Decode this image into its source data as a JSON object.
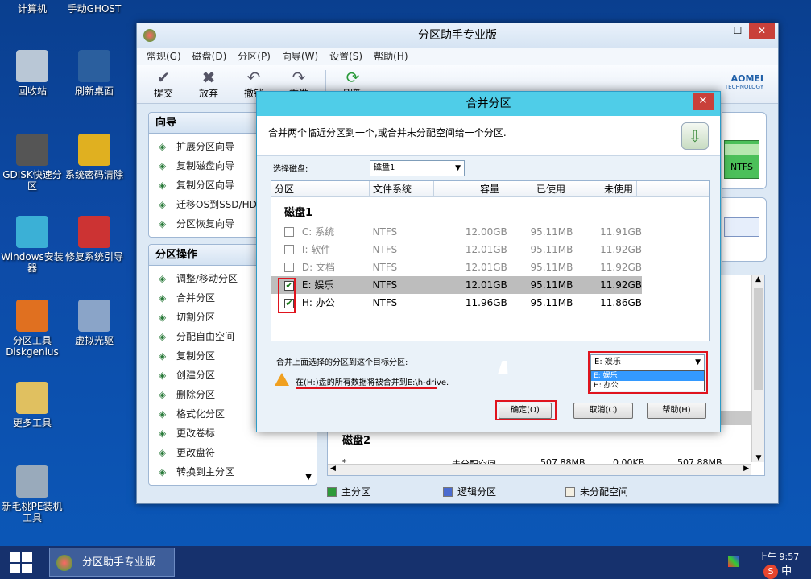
{
  "desktop": {
    "icons": [
      {
        "label": "计算机"
      },
      {
        "label": "手动GHOST"
      },
      {
        "label": "回收站"
      },
      {
        "label": "刷新桌面"
      },
      {
        "label": "GDISK快速分区"
      },
      {
        "label": "系统密码清除"
      },
      {
        "label": "Windows安装器"
      },
      {
        "label": "修复系统引导"
      },
      {
        "label": "分区工具Diskgenius"
      },
      {
        "label": "虚拟光驱"
      },
      {
        "label": "更多工具"
      },
      {
        "label": "新毛桃PE装机工具"
      }
    ]
  },
  "app": {
    "title": "分区助手专业版",
    "menu": [
      "常规(G)",
      "磁盘(D)",
      "分区(P)",
      "向导(W)",
      "设置(S)",
      "帮助(H)"
    ],
    "toolbar": [
      "提交",
      "放弃",
      "撤销",
      "重做",
      "刷新"
    ],
    "brand": "AOMEI",
    "brand_sub": "TECHNOLOGY",
    "wizard_title": "向导",
    "wizards": [
      "扩展分区向导",
      "复制磁盘向导",
      "复制分区向导",
      "迁移OS到SSD/HDD",
      "分区恢复向导"
    ],
    "ops_title": "分区操作",
    "ops": [
      "调整/移动分区",
      "合并分区",
      "切割分区",
      "分配自由空间",
      "复制分区",
      "创建分区",
      "删除分区",
      "格式化分区",
      "更改卷标",
      "更改盘符",
      "转换到主分区"
    ],
    "fs_tag": "NTFS",
    "disk2": "磁盘2",
    "disk2_row": [
      "*",
      "未分配空间",
      "507.88MB",
      "0.00KB",
      "507.88MB"
    ],
    "legend": [
      "主分区",
      "逻辑分区",
      "未分配空间"
    ],
    "legend_colors": [
      "#2e9a3a",
      "#4a6bd0",
      "#f3efe2"
    ]
  },
  "dialog": {
    "title": "合并分区",
    "desc": "合并两个临近分区到一个,或合并未分配空间给一个分区.",
    "select_disk_label": "选择磁盘:",
    "select_disk_value": "磁盘1",
    "columns": [
      "分区",
      "文件系统",
      "容量",
      "已使用",
      "未使用"
    ],
    "disk_label": "磁盘1",
    "rows": [
      {
        "name": "C:  系统",
        "fs": "NTFS",
        "cap": "12.00GB",
        "used": "95.11MB",
        "free": "11.91GB",
        "checked": "",
        "enabled": false
      },
      {
        "name": "I:  软件",
        "fs": "NTFS",
        "cap": "12.01GB",
        "used": "95.11MB",
        "free": "11.92GB",
        "checked": "",
        "enabled": false
      },
      {
        "name": "D:  文档",
        "fs": "NTFS",
        "cap": "12.01GB",
        "used": "95.11MB",
        "free": "11.92GB",
        "checked": "",
        "enabled": false
      },
      {
        "name": "E:  娱乐",
        "fs": "NTFS",
        "cap": "12.01GB",
        "used": "95.11MB",
        "free": "11.92GB",
        "checked": "✔",
        "enabled": true
      },
      {
        "name": "H:  办公",
        "fs": "NTFS",
        "cap": "11.96GB",
        "used": "95.11MB",
        "free": "11.86GB",
        "checked": "✔",
        "enabled": true
      }
    ],
    "merge_target_label": "合并上面选择的分区到这个目标分区:",
    "target_value": "E:  娱乐",
    "target_options": [
      "E:  娱乐",
      "H:  办公"
    ],
    "warning": "在(H:)盘的所有数据将被合并到E:\\h-drive.",
    "ok": "确定(O)",
    "cancel": "取消(C)",
    "help": "帮助(H)"
  },
  "taskbar": {
    "item": "分区助手专业版",
    "time": "上午 9:57",
    "ime": "中"
  }
}
